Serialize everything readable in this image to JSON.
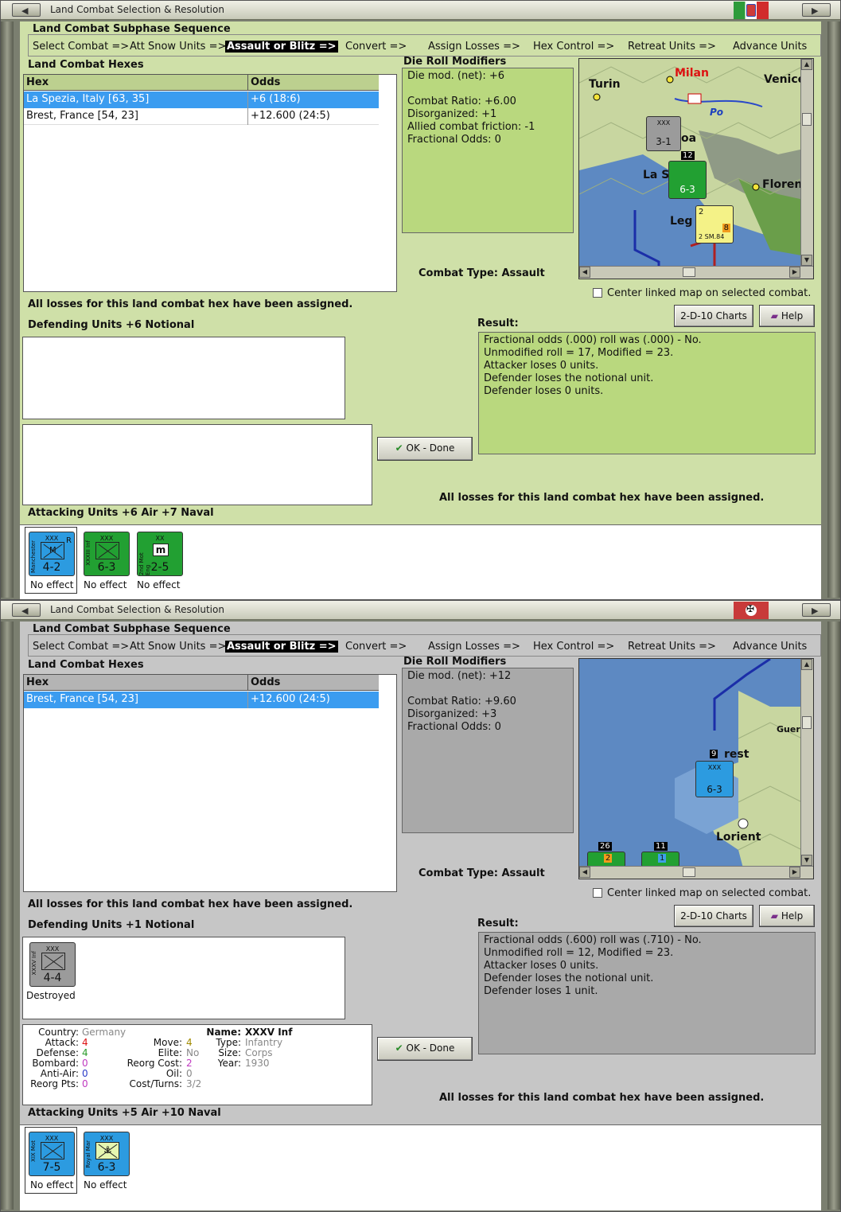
{
  "window_title": "Land Combat Selection & Resolution",
  "sequence": {
    "title": "Land Combat Subphase Sequence",
    "steps": [
      "Select Combat =>",
      "Att Snow Units =>",
      "Assault or Blitz =>",
      "Convert =>",
      "Assign Losses =>",
      "Hex Control =>",
      "Retreat Units =>",
      "Advance Units"
    ],
    "active_step": "Assault or Blitz =>"
  },
  "headers": {
    "hexes_title": "Land Combat Hexes",
    "col_hex": "Hex",
    "col_odds": "Odds",
    "drm_title": "Die Roll Modifiers",
    "combat_type_label": "Combat Type:  Assault",
    "center_map": "Center linked map on selected combat.",
    "charts_button": "2-D-10 Charts",
    "help_button": "Help",
    "ok_button": "OK - Done",
    "result_title": "Result:",
    "losses_assigned": "All losses for this land combat hex have been assigned."
  },
  "colors": {
    "italy_panel": "#cfe0a8",
    "germany_panel": "#c6c6c6",
    "selected_row": "#3b9cf0",
    "active_step": "#000000"
  },
  "window1": {
    "nation": "Italy",
    "hexes": [
      {
        "hex": "La Spezia, Italy [63, 35]",
        "odds": "+6 (18:6)",
        "selected": true
      },
      {
        "hex": "Brest, France [54, 23]",
        "odds": "+12.600 (24:5)",
        "selected": false
      }
    ],
    "drm": [
      "Die mod. (net): +6",
      "",
      "Combat Ratio: +6.00",
      "Disorganized: +1",
      "Allied combat friction: -1",
      "Fractional Odds: 0"
    ],
    "defending_title": "Defending Units +6 Notional",
    "attacking_title": "Attacking Units +6 Air +7 Naval",
    "result": [
      "Fractional odds (.000) roll was (.000)  - No.",
      "Unmodified roll = 17, Modified = 23.",
      "Attacker loses 0 units.",
      "Defender loses the notional unit.",
      "Defender loses 0 units."
    ],
    "map_labels": [
      "Turin",
      "Milan",
      "Venice",
      "Po",
      "oa",
      "La S",
      "Floren",
      "Leg"
    ],
    "map_counters": [
      {
        "top": "XXX",
        "vals": "3-1",
        "badge": "12"
      },
      {
        "vals": "6-3"
      },
      {
        "top": "2",
        "vals": "2 SM.84",
        "badge": "8"
      }
    ],
    "attackers": [
      {
        "side": "Manchester",
        "top": "XXX",
        "mark": "M",
        "corner": "R",
        "vals": "4-2",
        "color": "blue",
        "effect": "No effect"
      },
      {
        "side": "XXXIII Inf",
        "top": "XXX",
        "vals": "6-3",
        "color": "green",
        "effect": "No effect"
      },
      {
        "side": "2nd Mot Eng",
        "top": "XX",
        "mark": "m",
        "vals": "2-5",
        "color": "green",
        "effect": "No effect"
      }
    ]
  },
  "window2": {
    "nation": "Germany",
    "hexes": [
      {
        "hex": "Brest, France [54, 23]",
        "odds": "+12.600 (24:5)",
        "selected": true
      }
    ],
    "drm": [
      "Die mod. (net): +12",
      "",
      "Combat Ratio: +9.60",
      "Disorganized: +3",
      "Fractional Odds: 0"
    ],
    "defending_title": "Defending Units +1 Notional",
    "attacking_title": "Attacking Units +5 Air +10 Naval",
    "result": [
      "Fractional odds (.600) roll was (.710)  - No.",
      "Unmodified roll = 12, Modified = 23.",
      "Attacker loses 0 units.",
      "Defender loses the notional unit.",
      "Defender loses 1 unit."
    ],
    "map_labels": [
      "Guer",
      "rest",
      "Lorient"
    ],
    "map_counters": [
      {
        "top": "XXX",
        "vals": "6-3",
        "badge": "9"
      },
      {
        "vals": "2",
        "badge": "26"
      },
      {
        "vals": "1",
        "badge": "11"
      }
    ],
    "defenders": [
      {
        "side": "XXXV Inf",
        "top": "XXX",
        "vals": "4-4",
        "color": "gray",
        "effect": "Destroyed"
      }
    ],
    "unit_info": {
      "country_k": "Country:",
      "country_v": "Germany",
      "attack_k": "Attack:",
      "attack_v": "4",
      "defense_k": "Defense:",
      "defense_v": "4",
      "bombard_k": "Bombard:",
      "bombard_v": "0",
      "antiair_k": "Anti-Air:",
      "antiair_v": "0",
      "reorgpts_k": "Reorg Pts:",
      "reorgpts_v": "0",
      "move_k": "Move:",
      "move_v": "4",
      "elite_k": "Elite:",
      "elite_v": "No",
      "reorgcost_k": "Reorg Cost:",
      "reorgcost_v": "2",
      "oil_k": "Oil:",
      "oil_v": "0",
      "costturns_k": "Cost/Turns:",
      "costturns_v": "3/2",
      "name_k": "Name:",
      "name_v": "XXXV Inf",
      "type_k": "Type:",
      "type_v": "Infantry",
      "size_k": "Size:",
      "size_v": "Corps",
      "year_k": "Year:",
      "year_v": "1930"
    },
    "attackers": [
      {
        "side": "XIX Mot",
        "top": "XXX",
        "vals": "7-5",
        "color": "blue",
        "effect": "No effect"
      },
      {
        "side": "Royal Mar",
        "top": "XXX",
        "mark": "⚓",
        "vals": "6-3",
        "color": "blue",
        "effect": "No effect"
      }
    ]
  }
}
